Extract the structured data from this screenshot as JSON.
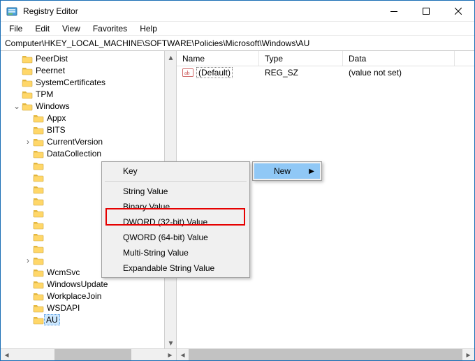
{
  "window": {
    "title": "Registry Editor"
  },
  "menubar": [
    "File",
    "Edit",
    "View",
    "Favorites",
    "Help"
  ],
  "address": "Computer\\HKEY_LOCAL_MACHINE\\SOFTWARE\\Policies\\Microsoft\\Windows\\AU",
  "tree": [
    {
      "indent": 6,
      "twisty": "",
      "label": "PeerDist"
    },
    {
      "indent": 6,
      "twisty": "",
      "label": "Peernet"
    },
    {
      "indent": 6,
      "twisty": "",
      "label": "SystemCertificates"
    },
    {
      "indent": 6,
      "twisty": "",
      "label": "TPM"
    },
    {
      "indent": 6,
      "twisty": "v",
      "label": "Windows"
    },
    {
      "indent": 7,
      "twisty": "",
      "label": "Appx"
    },
    {
      "indent": 7,
      "twisty": "",
      "label": "BITS"
    },
    {
      "indent": 7,
      "twisty": ">",
      "label": "CurrentVersion"
    },
    {
      "indent": 7,
      "twisty": "",
      "label": "DataCollection"
    },
    {
      "indent": 7,
      "twisty": "",
      "label": ""
    },
    {
      "indent": 7,
      "twisty": "",
      "label": ""
    },
    {
      "indent": 7,
      "twisty": "",
      "label": ""
    },
    {
      "indent": 7,
      "twisty": "",
      "label": ""
    },
    {
      "indent": 7,
      "twisty": "",
      "label": ""
    },
    {
      "indent": 7,
      "twisty": "",
      "label": ""
    },
    {
      "indent": 7,
      "twisty": "",
      "label": ""
    },
    {
      "indent": 7,
      "twisty": "",
      "label": ""
    },
    {
      "indent": 7,
      "twisty": ">",
      "label": ""
    },
    {
      "indent": 7,
      "twisty": "",
      "label": "WcmSvc"
    },
    {
      "indent": 7,
      "twisty": "",
      "label": "WindowsUpdate"
    },
    {
      "indent": 7,
      "twisty": "",
      "label": "WorkplaceJoin"
    },
    {
      "indent": 7,
      "twisty": "",
      "label": "WSDAPI"
    },
    {
      "indent": 7,
      "twisty": "",
      "label": "AU",
      "selected": true
    }
  ],
  "columns": {
    "name": "Name",
    "type": "Type",
    "data": "Data"
  },
  "values": [
    {
      "name": "(Default)",
      "type": "REG_SZ",
      "data": "(value not set)"
    }
  ],
  "context_primary": {
    "new": "New"
  },
  "context_new": [
    "Key",
    "---",
    "String Value",
    "Binary Value",
    "DWORD (32-bit) Value",
    "QWORD (64-bit) Value",
    "Multi-String Value",
    "Expandable String Value"
  ],
  "highlighted_item": "DWORD (32-bit) Value",
  "colwidths": {
    "name": 118,
    "type": 120,
    "data": 160
  }
}
